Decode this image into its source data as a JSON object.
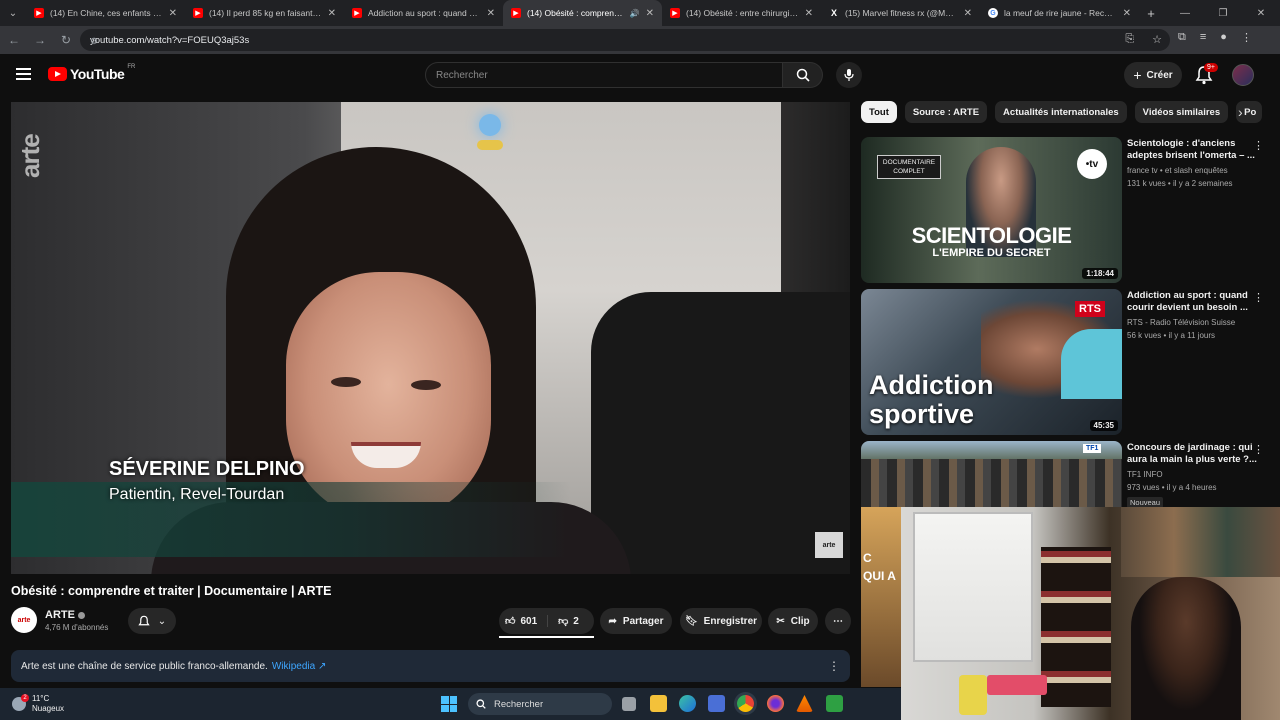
{
  "browser": {
    "tabs": [
      {
        "title": "(14) En Chine, ces enfants porte",
        "favicon": "youtube",
        "active": false
      },
      {
        "title": "(14) Il perd 85 kg en faisant de",
        "favicon": "youtube",
        "active": false
      },
      {
        "title": "Addiction au sport : quand cou",
        "favicon": "youtube",
        "active": false
      },
      {
        "title": "(14) Obésité : comprendre",
        "favicon": "youtube",
        "active": true
      },
      {
        "title": "(14) Obésité : entre chirurgie e",
        "favicon": "youtube",
        "active": false
      },
      {
        "title": "(15) Marvel fitness rx (@Marve",
        "favicon": "x",
        "active": false
      },
      {
        "title": "la meuf de rire jaune - Recherc",
        "favicon": "google",
        "active": false
      }
    ],
    "url": "youtube.com/watch?v=FOEUQ3aj53s"
  },
  "header": {
    "logo_text": "YouTube",
    "country": "FR",
    "search_placeholder": "Rechercher",
    "create_label": "Créer",
    "notif_count": "9+"
  },
  "video": {
    "watermark": "arte",
    "person_name": "SÉVERINE DELPINO",
    "person_role": "Patientin, Revel-Tourdan",
    "corner_logo": "arte",
    "title": "Obésité : comprendre et traiter | Documentaire | ARTE"
  },
  "channel": {
    "avatar_text": "arte",
    "name": "ARTE",
    "subscribers": "4,76 M d'abonnés"
  },
  "actions": {
    "likes": "601",
    "dislikes": "2",
    "share": "Partager",
    "save": "Enregistrer",
    "clip": "Clip"
  },
  "description": {
    "text": "Arte est une chaîne de service public franco-allemande.",
    "link": "Wikipedia ↗"
  },
  "chips": [
    "Tout",
    "Source : ARTE",
    "Actualités internationales",
    "Vidéos similaires",
    "Po"
  ],
  "recommendations": [
    {
      "title": "Scientologie : d'anciens adeptes brisent l'omerta – ...",
      "channel": "france tv • et slash enquêtes",
      "meta": "131 k vues • il y a 2 semaines",
      "duration": "1:18:44",
      "thumb_big": "SCIENTOLOGIE",
      "thumb_sub": "L'EMPIRE DU SECRET",
      "thumb_tag": "DOCUMENTAIRE COMPLET",
      "thumb_logo": "•tv"
    },
    {
      "title": "Addiction au sport : quand courir devient un besoin ...",
      "channel": "RTS - Radio Télévision Suisse",
      "meta": "56 k vues • il y a 11 jours",
      "duration": "45:35",
      "thumb_big": "Addiction sportive",
      "thumb_logo": "RTS"
    },
    {
      "title": "Concours de jardinage : qui aura la main la plus verte ?...",
      "channel": "TF1 INFO",
      "meta": "973 vues • il y a 4 heures",
      "badge": "Nouveau",
      "thumb_logo": "TF1"
    }
  ],
  "partial_thumb_text": [
    "C",
    "QUI A"
  ],
  "taskbar": {
    "temperature": "11°C",
    "weather": "Nuageux",
    "weather_badge": "2",
    "search_label": "Rechercher"
  },
  "colors": {
    "background": "#0f0f0f",
    "youtube_red": "#ff0000",
    "link_blue": "#3ea6ff",
    "chip_bg": "#272727"
  }
}
